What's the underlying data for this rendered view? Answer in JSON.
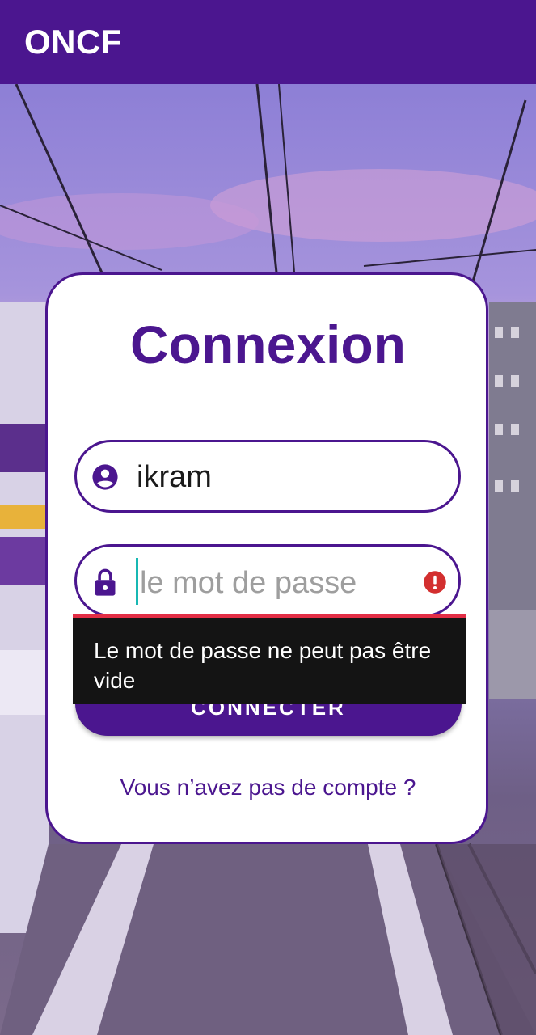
{
  "app_bar": {
    "title": "ONCF"
  },
  "login_card": {
    "title": "Connexion",
    "username_field": {
      "value": "ikram",
      "icon": "account-circle-icon"
    },
    "password_field": {
      "value": "",
      "placeholder": "le mot de passe",
      "icon": "lock-icon",
      "error_icon": "error-icon"
    },
    "error_tooltip": "Le mot de passe ne peut pas être vide",
    "connect_button": "CONNECTER",
    "signup_link": "Vous n’avez pas de compte ?"
  },
  "colors": {
    "primary": "#4b168f",
    "error": "#e22d45",
    "tooltip_bg": "#141414",
    "cursor": "#18b8b3"
  }
}
